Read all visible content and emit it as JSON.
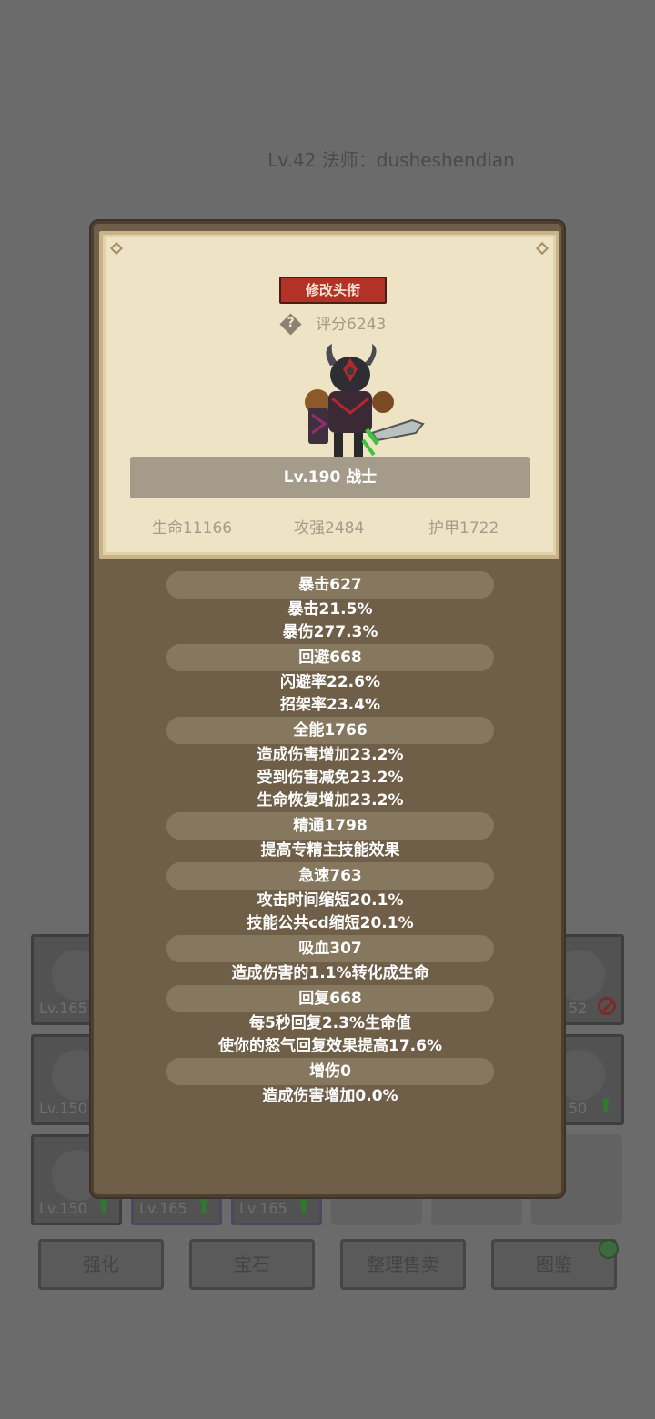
{
  "header": {
    "text": "Lv.42 法师：dusheshendian"
  },
  "inventory": {
    "rows": [
      [
        {
          "level": "Lv.165"
        },
        {
          "level": "52",
          "status": "ban"
        }
      ],
      [
        {
          "level": "Lv.150"
        },
        {
          "level": "50",
          "status": "upgrade"
        }
      ],
      [
        {
          "level": "Lv.150",
          "status": "upgrade"
        },
        {
          "level": "Lv.165",
          "status": "upgrade"
        },
        {
          "level": "Lv.165",
          "status": "upgrade"
        }
      ]
    ]
  },
  "bottom_buttons": [
    "强化",
    "宝石",
    "整理售卖",
    "图鉴"
  ],
  "modal": {
    "edit_title_label": "修改头衔",
    "score": "评分6243",
    "name": "Lv.190 战士",
    "stats": {
      "hp": "生命11166",
      "atk": "攻强2484",
      "armor": "护甲1722"
    },
    "groups": [
      {
        "head": "暴击627",
        "lines": [
          "暴击21.5%",
          "暴伤277.3%"
        ]
      },
      {
        "head": "回避668",
        "lines": [
          "闪避率22.6%",
          "招架率23.4%"
        ]
      },
      {
        "head": "全能1766",
        "lines": [
          "造成伤害增加23.2%",
          "受到伤害减免23.2%",
          "生命恢复增加23.2%"
        ]
      },
      {
        "head": "精通1798",
        "lines": [
          "提高专精主技能效果"
        ]
      },
      {
        "head": "急速763",
        "lines": [
          "攻击时间缩短20.1%",
          "技能公共cd缩短20.1%"
        ]
      },
      {
        "head": "吸血307",
        "lines": [
          "造成伤害的1.1%转化成生命"
        ]
      },
      {
        "head": "回复668",
        "lines": [
          "每5秒回复2.3%生命值",
          "使你的怒气回复效果提高17.6%"
        ]
      },
      {
        "head": "增伤0",
        "lines": [
          "造成伤害增加0.0%"
        ]
      }
    ]
  },
  "colors": {
    "accent_red": "#b23228",
    "panel": "#6f5e48",
    "card": "#eee3c5",
    "upgrade_green": "#2f7a2f"
  }
}
